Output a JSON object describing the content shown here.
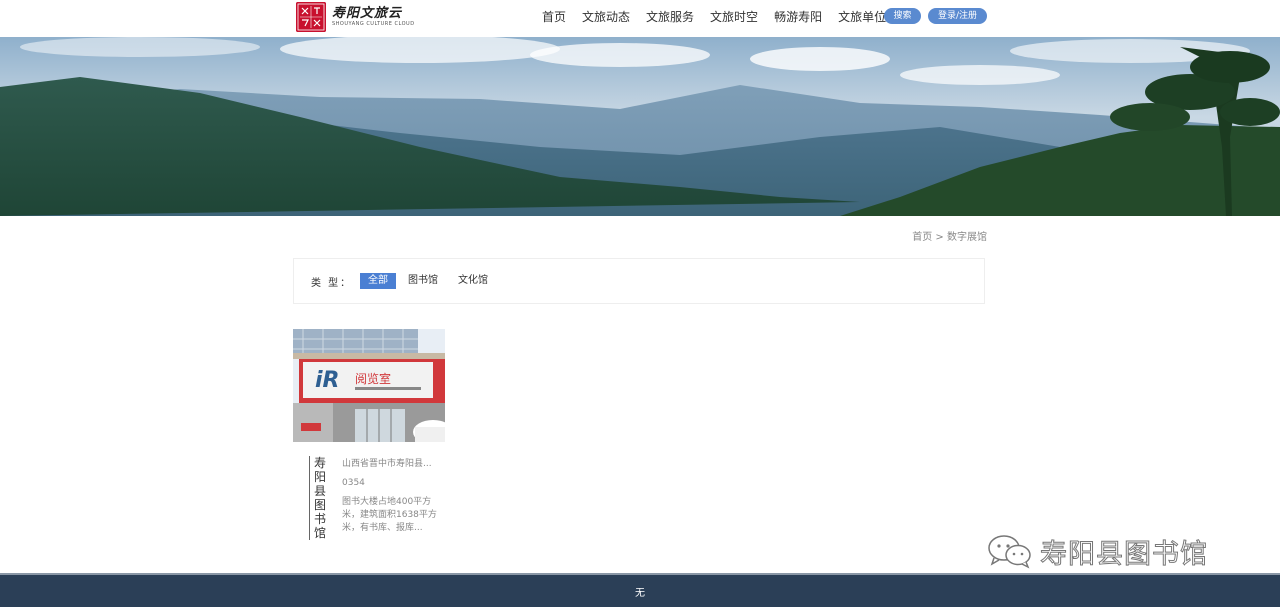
{
  "header": {
    "logo_seal_text": "文旅寿阳",
    "logo_cn": "寿阳文旅云",
    "logo_en": "SHOUYANG CULTURE CLOUD",
    "nav": [
      "首页",
      "文旅动态",
      "文旅服务",
      "文旅时空",
      "畅游寿阳",
      "文旅单位"
    ],
    "search_label": "搜索",
    "login_label": "登录/注册",
    "accent_color": "#5a8ad0"
  },
  "breadcrumb": {
    "home": "首页",
    "separator": ">",
    "current": "数字展馆"
  },
  "filter": {
    "label": "类 型：",
    "options": [
      "全部",
      "图书馆",
      "文化馆"
    ],
    "active_index": 0,
    "active_color": "#4a7fd3"
  },
  "cards": [
    {
      "title": "寿阳县图书馆",
      "address": "山西省晋中市寿阳县...",
      "phone": "0354",
      "description": "图书大楼占地400平方米，建筑面积1638平方米，有书库、报库...",
      "image_sign_text": "阅览室"
    }
  ],
  "watermark": {
    "icon": "wechat-icon",
    "text": "寿阳县图书馆"
  },
  "footer": {
    "text": "无",
    "color": "#2b3f57"
  }
}
